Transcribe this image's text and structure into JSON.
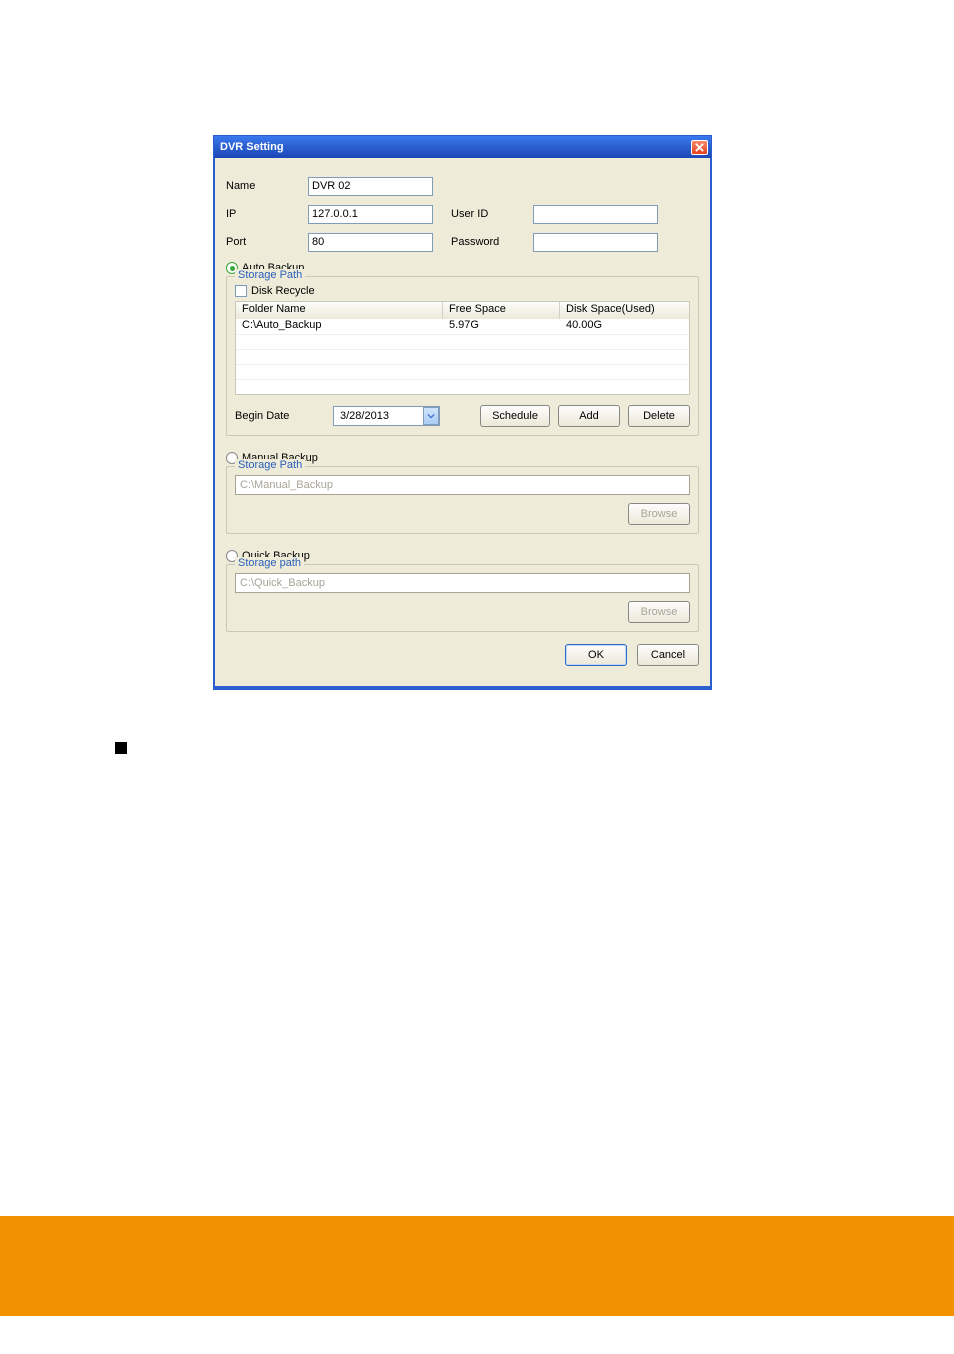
{
  "dialog": {
    "title": "DVR Setting",
    "labels": {
      "name": "Name",
      "ip": "IP",
      "port": "Port",
      "user_id": "User ID",
      "password": "Password"
    },
    "values": {
      "name": "DVR 02",
      "ip": "127.0.0.1",
      "port": "80",
      "user_id": "",
      "password": ""
    },
    "auto_backup": {
      "radio_label": "Auto Backup",
      "legend": "Storage Path",
      "disk_recycle_label": "Disk Recycle",
      "table": {
        "headers": {
          "folder": "Folder Name",
          "free": "Free Space",
          "disk": "Disk Space(Used)"
        },
        "rows": [
          {
            "folder": "C:\\Auto_Backup",
            "free": "5.97G",
            "disk": "40.00G"
          },
          {
            "folder": "",
            "free": "",
            "disk": ""
          },
          {
            "folder": "",
            "free": "",
            "disk": ""
          },
          {
            "folder": "",
            "free": "",
            "disk": ""
          },
          {
            "folder": "",
            "free": "",
            "disk": ""
          }
        ]
      },
      "begin_date_label": "Begin Date",
      "begin_date_value": "3/28/2013",
      "buttons": {
        "schedule": "Schedule",
        "add": "Add",
        "delete": "Delete"
      }
    },
    "manual_backup": {
      "radio_label": "Manual Backup",
      "legend": "Storage Path",
      "path": "C:\\Manual_Backup",
      "browse": "Browse"
    },
    "quick_backup": {
      "radio_label": "Quick Backup",
      "legend": "Storage path",
      "path": "C:\\Quick_Backup",
      "browse": "Browse"
    },
    "buttons": {
      "ok": "OK",
      "cancel": "Cancel"
    }
  }
}
